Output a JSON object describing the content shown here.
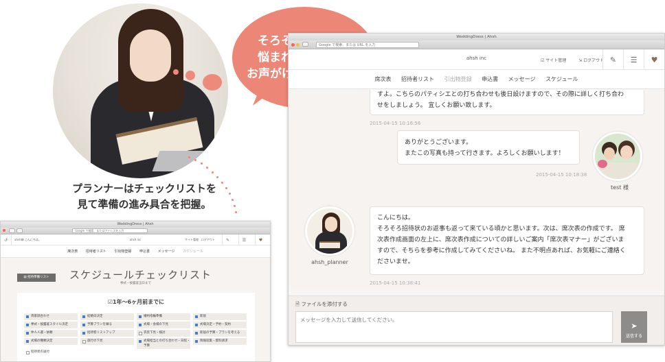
{
  "promo": {
    "speech_lines": [
      "そろそろ席次表で",
      "悩まれる頃なので",
      "お声がけしてみよう!!"
    ],
    "caption_lines": [
      "プランナーはチェックリストを",
      "見て準備の進み具合を把握。"
    ]
  },
  "message_window": {
    "window_title": "WeddingDress | Ahsh",
    "address_placeholder": "Google で検索、または URL を入力",
    "brand": "ahsh inc",
    "header_links": [
      "サイト管理",
      "ログアウト"
    ],
    "nav": [
      "席次表",
      "招待者リスト",
      "引出物登録",
      "申込書",
      "メッセージ",
      "スケジュール"
    ],
    "messages": [
      {
        "lines": [
          "すよ。こちらのパティシエとの打ち合わせも後日設けますので、その際に詳しく打ち合わ",
          "せをしましょう。 宜しくお願い致します。"
        ],
        "time": "2015-04-15 10:16:56"
      },
      {
        "lines": [
          "ありがとうございます。",
          "またこの写真も持って行きます。よろしくお願いします！"
        ],
        "time": "2015-04-15 10:18:38",
        "sender": "test 様"
      },
      {
        "lines": [
          "こんにちは。",
          "そろそろ招待状のお返事も返って来ている頃かと思います。次は、席次表の作成です。 席",
          "次表作成画面の左上に、席次表作成についての詳しいご案内「席次表マナー」がございま",
          "すので、そちらを参考に作成してみてくださいね。 また不明点あれば、お気軽にご連絡く",
          "ださいませ。"
        ],
        "time": "2015-04-15 10:38:41",
        "sender": "ahsh_planner"
      }
    ],
    "composer": {
      "attach_label": "ファイルを添付する",
      "input_placeholder": "メッセージを入力して送信してください。",
      "send_label": "送信する"
    }
  },
  "checklist_window": {
    "window_title": "WeddingDress | Ahsh",
    "address_placeholder": "Google で検索、またはアドレスを入力",
    "user_label": "ahsh様 こんにちは。",
    "brand": "ahsh inc",
    "header_links": [
      "サイト管理",
      "ログアウト"
    ],
    "nav": [
      "席次表",
      "招待者リスト",
      "引出物登録",
      "申込書",
      "メッセージ",
      "スケジュール"
    ],
    "download_label": "招待準備リスト",
    "title": "スケジュールチェックリスト",
    "subtitle": "挙式・披露宴当日まで",
    "period_label": "1年〜6ヶ月前までに",
    "items": [
      {
        "label": "両家顔合わせ",
        "checked": true
      },
      {
        "label": "挙式・披露宴スタイル決定",
        "checked": true
      },
      {
        "label": "仲人人選・依頼",
        "checked": true
      },
      {
        "label": "式場の種類決定",
        "checked": true
      },
      {
        "label": "招待状の送付",
        "checked": false
      },
      {
        "label": "結婚日決定",
        "checked": true
      },
      {
        "label": "予算プランを練る",
        "checked": true
      },
      {
        "label": "招待客リストアップ",
        "checked": true
      },
      {
        "label": "旅行の下見",
        "checked": false
      },
      {
        "label": "婚約指輪準備",
        "checked": true
      },
      {
        "label": "式場・会場の下見",
        "checked": true
      },
      {
        "label": "衣装下見・検討",
        "checked": false
      },
      {
        "label": "式場担当との打ち合わせ・日程・予算",
        "checked": true
      },
      {
        "label": "新居",
        "checked": true
      },
      {
        "label": "式場決定・予約・契約",
        "checked": true
      },
      {
        "label": "新居の予算・プランを考える",
        "checked": true
      },
      {
        "label": "情報収集・資料請求",
        "checked": true
      }
    ]
  }
}
